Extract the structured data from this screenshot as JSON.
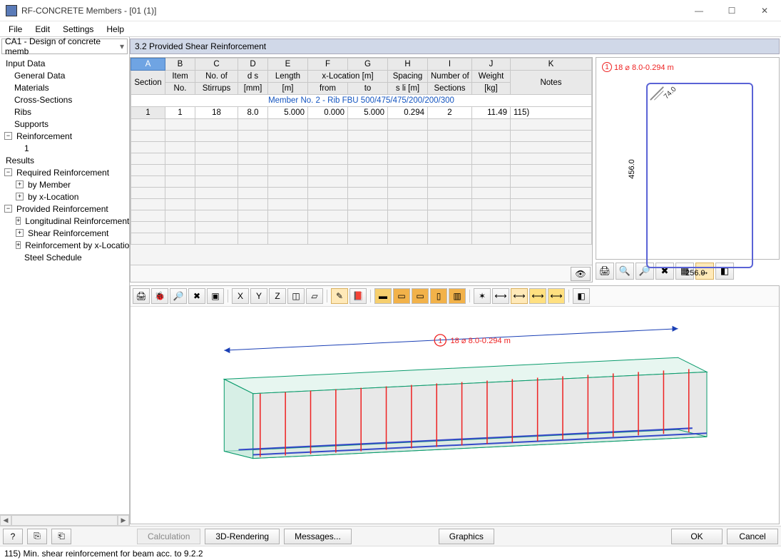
{
  "window_title": "RF-CONCRETE Members - [01 (1)]",
  "menu": [
    "File",
    "Edit",
    "Settings",
    "Help"
  ],
  "case_selector": "CA1 - Design of concrete memb",
  "nav": {
    "input_title": "Input Data",
    "input_children": [
      "General Data",
      "Materials",
      "Cross-Sections",
      "Ribs",
      "Supports"
    ],
    "reinforcement": "Reinforcement",
    "reinforcement_child": "1",
    "results_title": "Results",
    "required": "Required Reinforcement",
    "required_children": [
      "by Member",
      "by x-Location"
    ],
    "provided": "Provided Reinforcement",
    "provided_children": [
      "Longitudinal Reinforcement",
      "Shear Reinforcement",
      "Reinforcement by x-Location",
      "Steel Schedule"
    ]
  },
  "section_title": "3.2  Provided Shear Reinforcement",
  "table": {
    "col_letters": [
      "A",
      "B",
      "C",
      "D",
      "E",
      "F",
      "G",
      "H",
      "I",
      "J",
      "K"
    ],
    "head_r1": [
      "Section",
      "Item",
      "No. of",
      "d s",
      "Length",
      "x-Location [m]",
      "",
      "Spacing",
      "Number of",
      "Weight",
      ""
    ],
    "head_r2": [
      "",
      "No.",
      "Stirrups",
      "[mm]",
      "[m]",
      "from",
      "to",
      "s li [m]",
      "Sections",
      "[kg]",
      "Notes"
    ],
    "member_row": "Member No. 2  -  Rib FBU 500/475/475/200/200/300",
    "data_row": [
      "1",
      "1",
      "18",
      "8.0",
      "5.000",
      "0.000",
      "5.000",
      "0.294",
      "2",
      "11.49",
      "115)"
    ]
  },
  "cross_section": {
    "label_num": "1",
    "label_text": "18 ⌀ 8.0-0.294 m",
    "ch": "74.0",
    "height": "456.0",
    "width": "256.0"
  },
  "render": {
    "label_num": "1",
    "label_text": "18 ⌀ 8.0-0.294 m"
  },
  "bottom": {
    "calc": "Calculation",
    "render": "3D-Rendering",
    "messages": "Messages...",
    "graphics": "Graphics",
    "ok": "OK",
    "cancel": "Cancel"
  },
  "status": "115) Min. shear reinforcement for beam acc. to 9.2.2"
}
